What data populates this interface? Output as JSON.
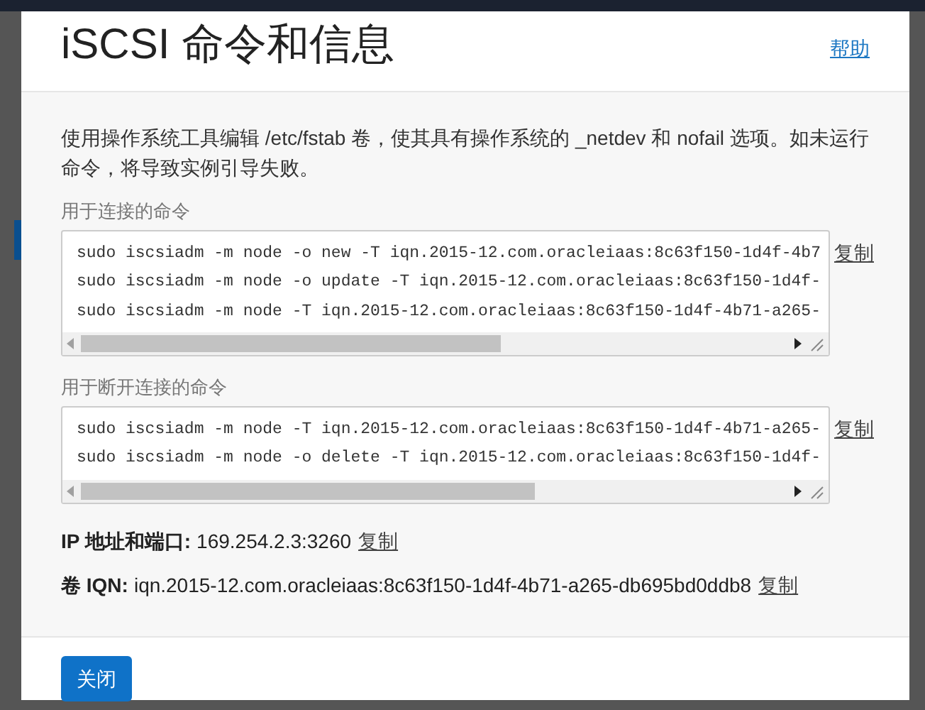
{
  "dialog": {
    "title": "iSCSI 命令和信息",
    "help_link": "帮助"
  },
  "description": "使用操作系统工具编辑 /etc/fstab 卷，使其具有操作系统的 _netdev 和 nofail 选项。如未运行命令，将导致实例引导失败。",
  "command_blocks": [
    {
      "label": "用于连接的命令",
      "lines": [
        "sudo iscsiadm -m node -o new -T iqn.2015-12.com.oracleiaas:8c63f150-1d4f-4b7",
        "sudo iscsiadm -m node -o update -T iqn.2015-12.com.oracleiaas:8c63f150-1d4f-",
        "sudo iscsiadm -m node -T iqn.2015-12.com.oracleiaas:8c63f150-1d4f-4b71-a265-"
      ],
      "copy_link": "复制"
    },
    {
      "label": "用于断开连接的命令",
      "lines": [
        "sudo iscsiadm -m node -T iqn.2015-12.com.oracleiaas:8c63f150-1d4f-4b71-a265-",
        "sudo iscsiadm -m node -o delete -T iqn.2015-12.com.oracleiaas:8c63f150-1d4f-"
      ],
      "copy_link": "复制"
    }
  ],
  "info": [
    {
      "label": "IP 地址和端口:",
      "value": "169.254.2.3:3260",
      "copy_link": "复制"
    },
    {
      "label": "卷 IQN:",
      "value": "iqn.2015-12.com.oracleiaas:8c63f150-1d4f-4b71-a265-db695bd0ddb8",
      "copy_link": "复制"
    }
  ],
  "footer": {
    "close_button": "关闭"
  }
}
